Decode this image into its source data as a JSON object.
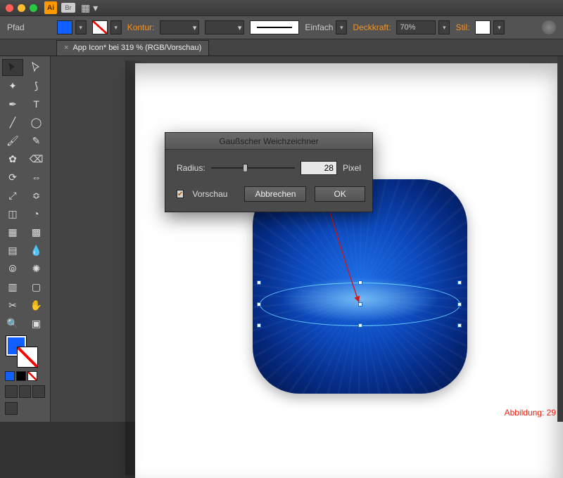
{
  "titlebar": {
    "app_badge": "Ai",
    "br_badge": "Br"
  },
  "controlbar": {
    "path_label": "Pfad",
    "stroke_label": "Kontur:",
    "stroke_style_label": "Einfach",
    "opacity_label": "Deckkraft:",
    "opacity_value": "70%",
    "style_label": "Stil:"
  },
  "doc_tab": {
    "title": "App Icon* bei 319 % (RGB/Vorschau)",
    "close": "×"
  },
  "dialog": {
    "title": "Gaußscher Weichzeichner",
    "radius_label": "Radius:",
    "radius_value": "28",
    "radius_unit": "Pixel",
    "preview_label": "Vorschau",
    "cancel": "Abbrechen",
    "ok": "OK"
  },
  "caption": "Abbildung: 29"
}
